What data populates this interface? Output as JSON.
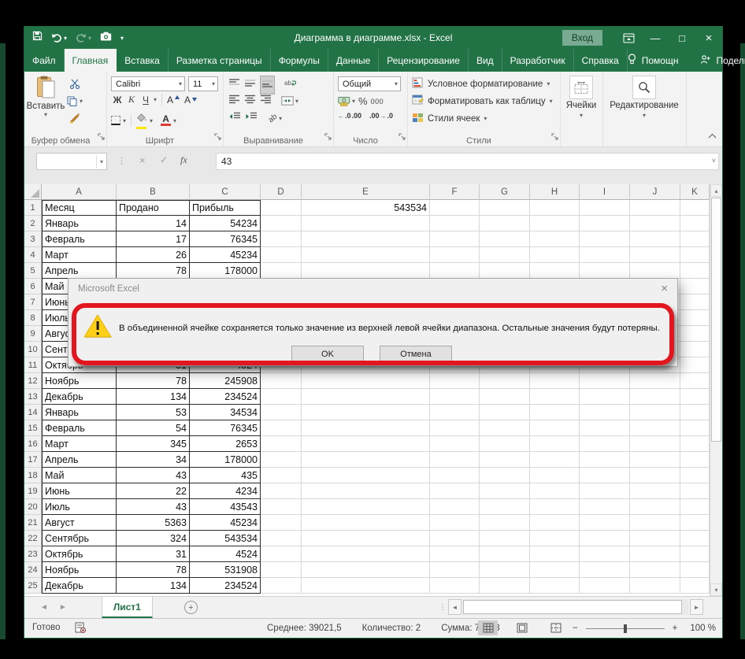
{
  "window": {
    "title": "Диаграмма в диаграмме.xlsx  -  Excel",
    "sign_in": "Вход",
    "controls": {
      "minimize": "—",
      "maximize": "□",
      "close": "×"
    }
  },
  "ribbon": {
    "tabs": [
      {
        "label": "Файл"
      },
      {
        "label": "Главная",
        "active": true
      },
      {
        "label": "Вставка"
      },
      {
        "label": "Разметка страницы"
      },
      {
        "label": "Формулы"
      },
      {
        "label": "Данные"
      },
      {
        "label": "Рецензирование"
      },
      {
        "label": "Вид"
      },
      {
        "label": "Разработчик"
      },
      {
        "label": "Справка"
      }
    ],
    "help_label": "Помощн",
    "share_label": "Поделиться",
    "clipboard": {
      "label": "Буфер обмена",
      "paste": "Вставить"
    },
    "font": {
      "label": "Шрифт",
      "name": "Calibri",
      "size": "11",
      "bold": "Ж",
      "italic": "К",
      "underline": "Ч",
      "grow": "А",
      "shrink": "А",
      "color_letter": "А"
    },
    "alignment": {
      "label": "Выравнивание",
      "orient": "ab"
    },
    "number": {
      "label": "Число",
      "format": "Общий",
      "percent": "%",
      "thousands": "000",
      "inc_decimal": ".0",
      "inc_decimal2": ".00",
      "dec_decimal": ".00",
      "dec_decimal2": ".0"
    },
    "styles": {
      "label": "Стили",
      "conditional": "Условное форматирование",
      "as_table": "Форматировать как таблицу",
      "cell_styles": "Стили ячеек"
    },
    "cells": {
      "label": "Ячейки"
    },
    "editing": {
      "label": "Редактирование"
    }
  },
  "formula_bar": {
    "value": "43",
    "fx": "fx",
    "cancel": "×",
    "enter": "✓"
  },
  "grid": {
    "columns": [
      "A",
      "B",
      "C",
      "D",
      "E",
      "F",
      "G",
      "H",
      "I",
      "J",
      "K"
    ],
    "rows": [
      {
        "n": "1",
        "a": "Месяц",
        "b": "Продано",
        "c": "Прибыль",
        "e": "543534"
      },
      {
        "n": "2",
        "a": "Январь",
        "b": "14",
        "c": "54234",
        "e": ""
      },
      {
        "n": "3",
        "a": "Февраль",
        "b": "17",
        "c": "76345",
        "e": ""
      },
      {
        "n": "4",
        "a": "Март",
        "b": "26",
        "c": "45234",
        "e": ""
      },
      {
        "n": "5",
        "a": "Апрель",
        "b": "78",
        "c": "178000",
        "e": ""
      },
      {
        "n": "6",
        "a": "Май",
        "b": "",
        "c": "",
        "e": ""
      },
      {
        "n": "7",
        "a": "Июнь",
        "b": "",
        "c": "",
        "e": ""
      },
      {
        "n": "8",
        "a": "Июль",
        "b": "",
        "c": "",
        "e": ""
      },
      {
        "n": "9",
        "a": "Август",
        "b": "",
        "c": "",
        "e": ""
      },
      {
        "n": "10",
        "a": "Сентябрь",
        "b": "",
        "c": "",
        "e": ""
      },
      {
        "n": "11",
        "a": "Октябрь",
        "b": "31",
        "c": "4524",
        "e": ""
      },
      {
        "n": "12",
        "a": "Ноябрь",
        "b": "78",
        "c": "245908",
        "e": ""
      },
      {
        "n": "13",
        "a": "Декабрь",
        "b": "134",
        "c": "234524",
        "e": ""
      },
      {
        "n": "14",
        "a": "Январь",
        "b": "53",
        "c": "34534",
        "e": ""
      },
      {
        "n": "15",
        "a": "Февраль",
        "b": "54",
        "c": "76345",
        "e": ""
      },
      {
        "n": "16",
        "a": "Март",
        "b": "345",
        "c": "2653",
        "e": ""
      },
      {
        "n": "17",
        "a": "Апрель",
        "b": "34",
        "c": "178000",
        "e": ""
      },
      {
        "n": "18",
        "a": "Май",
        "b": "43",
        "c": "435",
        "e": ""
      },
      {
        "n": "19",
        "a": "Июнь",
        "b": "22",
        "c": "4234",
        "e": ""
      },
      {
        "n": "20",
        "a": "Июль",
        "b": "43",
        "c": "43543",
        "e": ""
      },
      {
        "n": "21",
        "a": "Август",
        "b": "5363",
        "c": "45234",
        "e": ""
      },
      {
        "n": "22",
        "a": "Сентябрь",
        "b": "324",
        "c": "543534",
        "e": ""
      },
      {
        "n": "23",
        "a": "Октябрь",
        "b": "31",
        "c": "4524",
        "e": ""
      },
      {
        "n": "24",
        "a": "Ноябрь",
        "b": "78",
        "c": "531908",
        "e": ""
      },
      {
        "n": "25",
        "a": "Декабрь",
        "b": "134",
        "c": "234524",
        "e": ""
      }
    ]
  },
  "sheet": {
    "tab": "Лист1",
    "add": "+"
  },
  "status": {
    "ready": "Готово",
    "average": "Среднее: 39021,5",
    "count": "Количество: 2",
    "sum": "Сумма: 78043",
    "zoom": "100 %",
    "minus": "−",
    "plus": "+"
  },
  "dialog": {
    "title": "Microsoft Excel",
    "message": "В объединенной ячейке сохраняется только значение из верхней левой ячейки диапазона. Остальные значения будут потеряны.",
    "ok": "OK",
    "cancel": "Отмена",
    "close": "×"
  }
}
